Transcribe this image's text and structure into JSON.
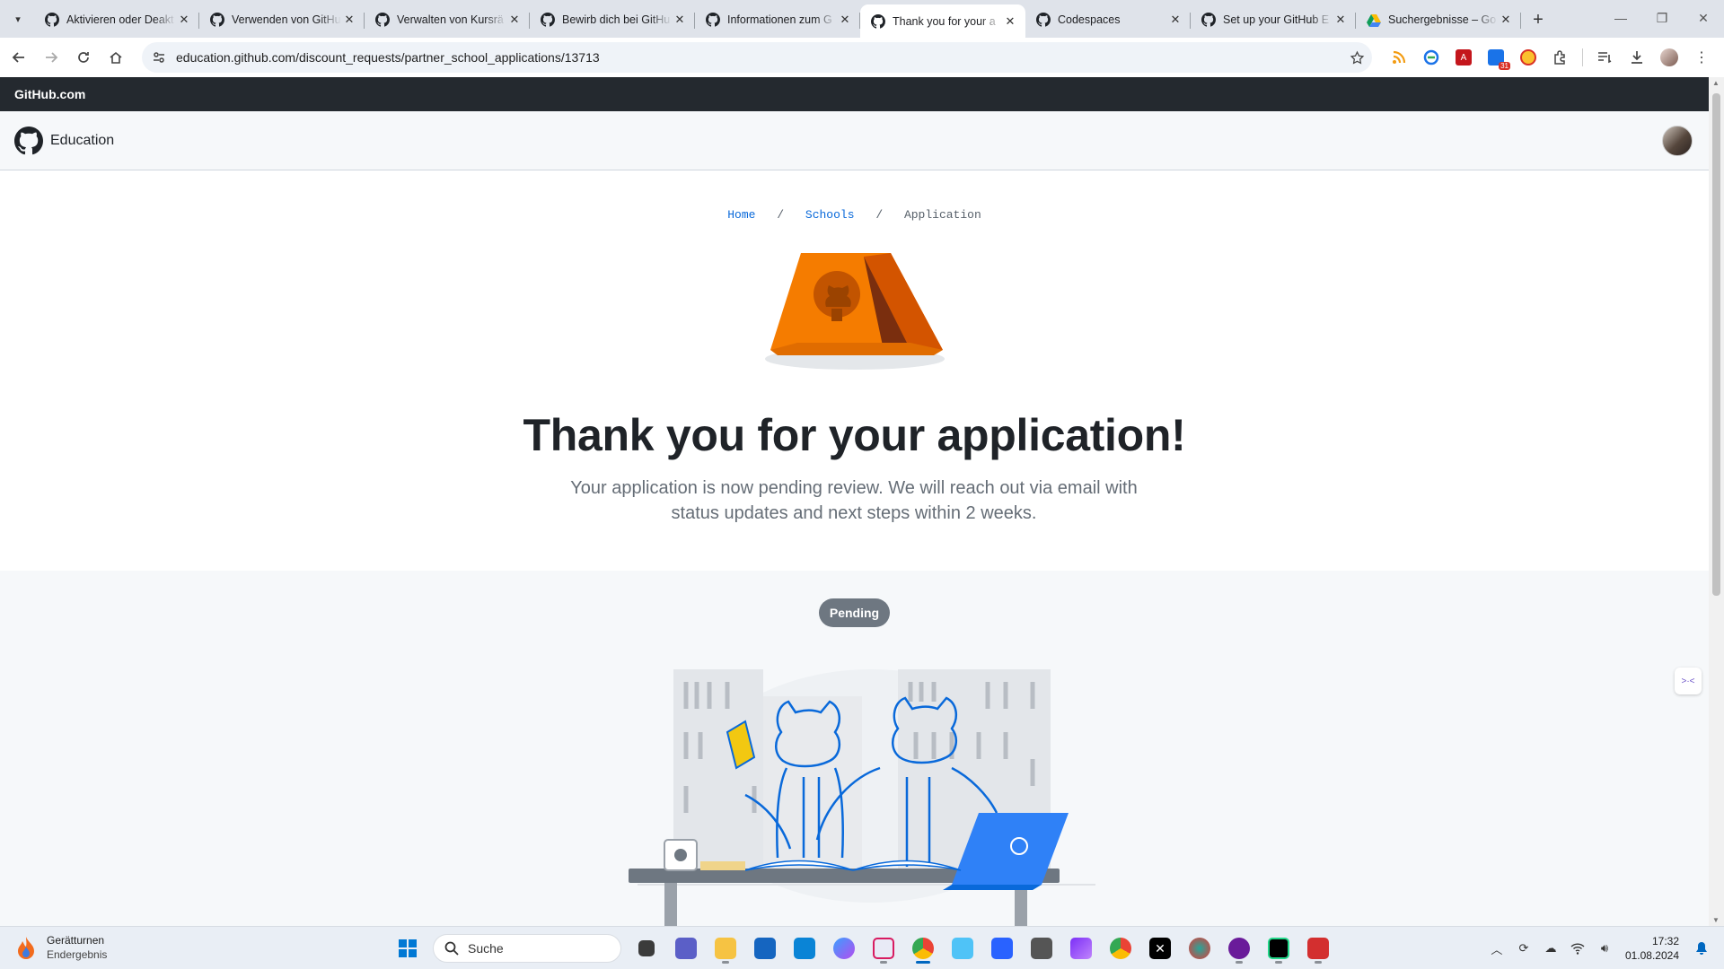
{
  "browser": {
    "tabs": [
      {
        "title": "Aktivieren oder Deakt",
        "icon": "github-icon"
      },
      {
        "title": "Verwenden von GitHu",
        "icon": "github-icon"
      },
      {
        "title": "Verwalten von Kursrä",
        "icon": "github-icon"
      },
      {
        "title": "Bewirb dich bei GitHu",
        "icon": "github-icon"
      },
      {
        "title": "Informationen zum G",
        "icon": "github-icon"
      },
      {
        "title": "Thank you for your a",
        "icon": "github-icon",
        "active": true
      },
      {
        "title": "Codespaces",
        "icon": "github-icon"
      },
      {
        "title": "Set up your GitHub E",
        "icon": "github-icon"
      },
      {
        "title": "Suchergebnisse – Go",
        "icon": "google-drive-icon"
      }
    ],
    "url": "education.github.com/discount_requests/partner_school_applications/13713"
  },
  "github_bar": {
    "label": "GitHub.com"
  },
  "edu_header": {
    "label": "Education"
  },
  "breadcrumb": {
    "home": "Home",
    "schools": "Schools",
    "current": "Application",
    "separator": "/"
  },
  "main": {
    "heading": "Thank you for your application!",
    "lead": "Your application is now pending review. We will reach out via email with status updates and next steps within 2 weeks."
  },
  "status": {
    "badge": "Pending"
  },
  "taskbar": {
    "weather_title": "Gerätturnen",
    "weather_sub": "Endergebnis",
    "search_placeholder": "Suche",
    "time": "17:32",
    "date": "01.08.2024",
    "calendar_badge": "31"
  },
  "colors": {
    "tent": "#f57c00",
    "dark_bar": "#24292f",
    "link": "#0969da",
    "badge": "#6e7781"
  }
}
